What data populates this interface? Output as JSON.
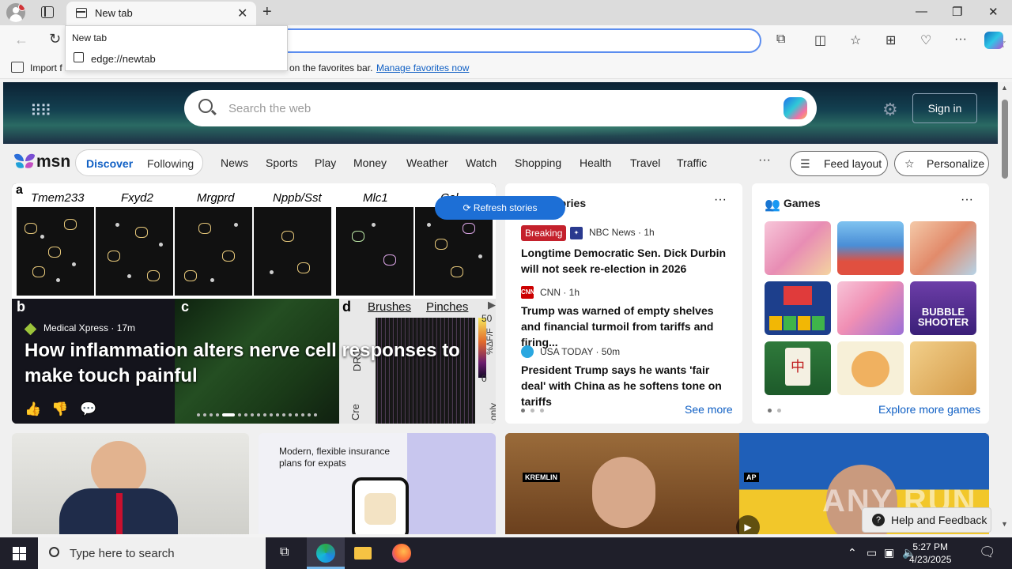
{
  "browser": {
    "tab_title": "New tab",
    "new_tab_symbol": "+",
    "window_controls": [
      "—",
      "❐",
      "✕"
    ],
    "dropdown": {
      "item1": "New tab",
      "item2": "edge://newtab"
    },
    "favbar": {
      "import_text": "Import f",
      "middle_text": "on the favorites bar.",
      "manage_link": "Manage favorites now"
    }
  },
  "msn": {
    "search_placeholder": "Search the web",
    "sign_in": "Sign in",
    "logo_text": "msn",
    "nav_pill": {
      "discover": "Discover",
      "following": "Following"
    },
    "nav_links": [
      "News",
      "Sports",
      "Play",
      "Money",
      "Weather",
      "Watch",
      "Shopping",
      "Health",
      "Travel",
      "Traffic"
    ],
    "nav_more": "···",
    "feed_layout": "Feed layout",
    "personalize": "Personalize"
  },
  "carousel": {
    "genes": [
      "Tmem233",
      "Fxyd2",
      "Mrgprd",
      "Nppb/Sst",
      "Mlc1",
      "Cal"
    ],
    "panel_labels": {
      "a": "a",
      "b": "b",
      "c": "c",
      "d": "d"
    },
    "d_headers": [
      "Brushes",
      "Pinches"
    ],
    "d_scale": [
      "50",
      "0"
    ],
    "d_axis": "%ΔF/F",
    "d_side": [
      "DRG",
      "Cre",
      "only"
    ],
    "refresh": "Refresh stories",
    "source": "Medical Xpress · 17m",
    "headline": "How inflammation alters nerve cell responses to make touch painful",
    "reactions": [
      "👍",
      "👎",
      "💬"
    ],
    "dot_count": 18,
    "active_dot": 4
  },
  "stories": {
    "title": "Top stories",
    "title_visible": "tories",
    "more": "···",
    "breaking": "Breaking",
    "items": [
      {
        "publisher": "NBC News · 1h",
        "headline": "Longtime Democratic Sen. Dick Durbin will not seek re-election in 2026"
      },
      {
        "publisher": "CNN · 1h",
        "headline": "Trump was warned of empty shelves and financial turmoil from tariffs and firing..."
      },
      {
        "publisher": "USA TODAY · 50m",
        "headline": "President Trump says he wants 'fair deal' with China as he softens tone on tariffs"
      }
    ],
    "see_more": "See more",
    "logo_text": {
      "cnn": "CNN"
    }
  },
  "games": {
    "title": "Games",
    "more": "···",
    "explore": "Explore more games",
    "tiles": [
      "dress-up",
      "diner",
      "restaurant-chef",
      "block-puzzle",
      "makeup",
      "bubble-shooter",
      "mahjong",
      "shiba-emoji",
      "wood-puzzle"
    ],
    "bubble_label": "BUBBLE SHOOTER"
  },
  "bottom": {
    "ad_text": "Modern, flexible insurance plans for expats",
    "tag_kremlin": "KREMLIN",
    "tag_ap": "AP",
    "help": "Help and Feedback",
    "watermark": "ANY RUN"
  },
  "taskbar": {
    "search_placeholder": "Type here to search",
    "time": "5:27 PM",
    "date": "4/23/2025"
  },
  "colors": {
    "accent": "#0f5fc4",
    "breaking": "#c4212c",
    "taskbar": "#1f1f2a"
  }
}
